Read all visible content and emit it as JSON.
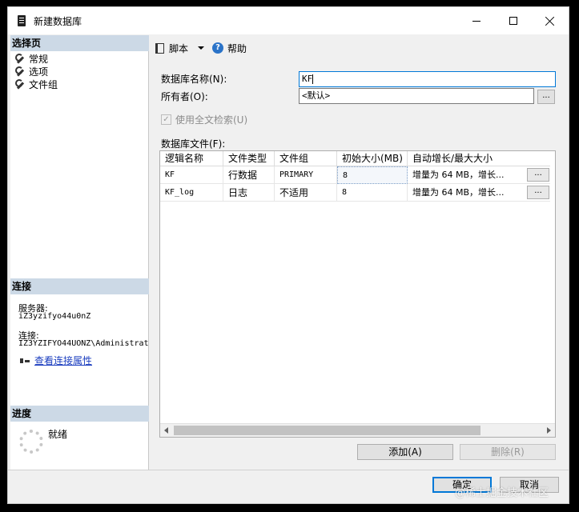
{
  "window": {
    "title": "新建数据库"
  },
  "left": {
    "select_page_header": "选择页",
    "pages": [
      {
        "label": "常规",
        "icon": "wrench-icon"
      },
      {
        "label": "选项",
        "icon": "wrench-icon"
      },
      {
        "label": "文件组",
        "icon": "wrench-icon"
      }
    ],
    "connection_header": "连接",
    "server_label": "服务器:",
    "server_value": "iZ3yzifyo44u0nZ",
    "connection_label": "连接:",
    "connection_value": "IZ3YZIFYO44UONZ\\Administrat",
    "view_props_link": "查看连接属性",
    "progress_header": "进度",
    "progress_status": "就绪"
  },
  "toolbar": {
    "script_label": "脚本",
    "help_label": "帮助"
  },
  "form": {
    "db_name_label": "数据库名称(N):",
    "db_name_value": "KF",
    "owner_label": "所有者(O):",
    "owner_value": "<默认>",
    "fulltext_label": "使用全文检索(U)",
    "fulltext_checked": true,
    "files_label": "数据库文件(F):",
    "ellipsis": "..."
  },
  "grid": {
    "columns": [
      "逻辑名称",
      "文件类型",
      "文件组",
      "初始大小(MB)",
      "自动增长/最大大小"
    ],
    "rows": [
      {
        "logical": "KF",
        "type": "行数据",
        "group": "PRIMARY",
        "size": "8",
        "growth": "增量为 64 MB，增长..."
      },
      {
        "logical": "KF_log",
        "type": "日志",
        "group": "不适用",
        "size": "8",
        "growth": "增量为 64 MB，增长..."
      }
    ],
    "cell_button": "..."
  },
  "buttons": {
    "add": "添加(A)",
    "remove": "删除(R)",
    "ok": "确定",
    "cancel": "取消"
  },
  "watermark": "@稀土掘金技术社区",
  "colors": {
    "section_header": "#ccd9e6",
    "link": "#1a3dbf",
    "focus": "#0078d7"
  }
}
